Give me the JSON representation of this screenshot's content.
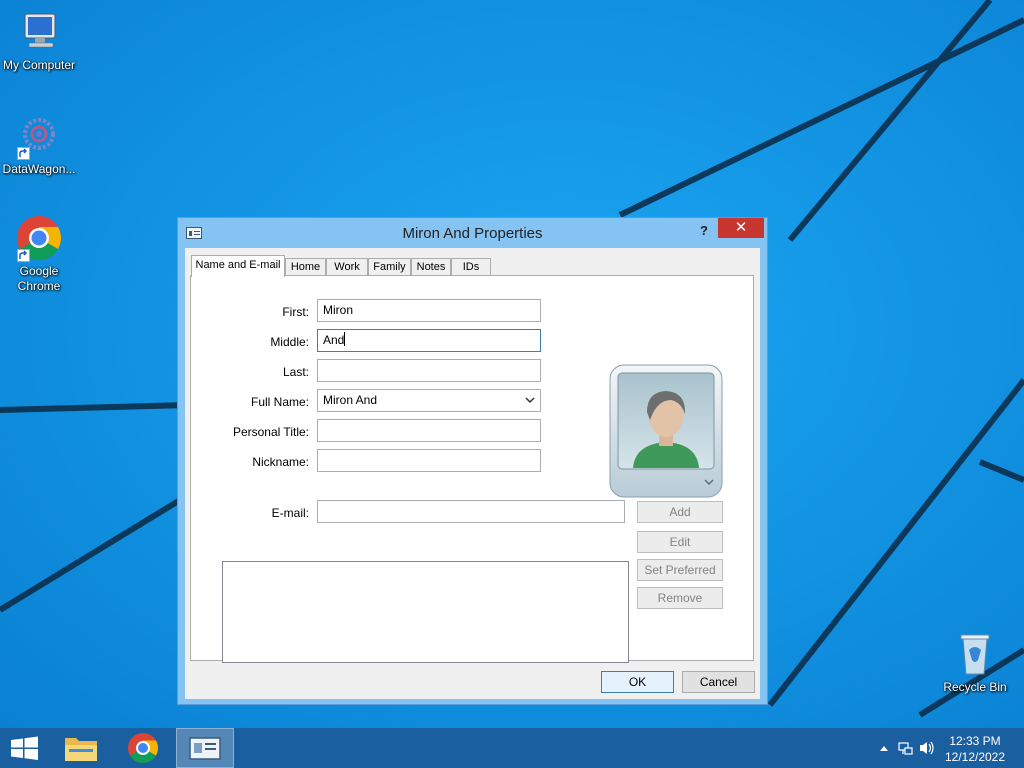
{
  "desktop": {
    "icons": [
      {
        "label": "My Computer",
        "icon": "my-computer-icon"
      },
      {
        "label": "DataWagon...",
        "icon": "datawagon-icon"
      },
      {
        "label": "Google Chrome",
        "icon": "chrome-icon"
      },
      {
        "label": "Recycle Bin",
        "icon": "recycle-bin-icon"
      }
    ]
  },
  "dialog": {
    "title": "Miron And Properties",
    "help_label": "?",
    "close_label": "✕",
    "tabs": [
      "Name and E-mail",
      "Home",
      "Work",
      "Family",
      "Notes",
      "IDs"
    ],
    "active_tab": "Name and E-mail",
    "form": {
      "first_label": "First:",
      "first_value": "Miron",
      "middle_label": "Middle:",
      "middle_value": "And",
      "last_label": "Last:",
      "last_value": "",
      "fullname_label": "Full Name:",
      "fullname_value": "Miron And",
      "title_label": "Personal Title:",
      "title_value": "",
      "nickname_label": "Nickname:",
      "nickname_value": "",
      "email_label": "E-mail:",
      "email_value": ""
    },
    "email_buttons": {
      "add": "Add",
      "edit": "Edit",
      "set_preferred": "Set Preferred",
      "remove": "Remove"
    },
    "footer": {
      "ok": "OK",
      "cancel": "Cancel"
    }
  },
  "taskbar": {
    "items": [
      "start-icon",
      "file-explorer-icon",
      "chrome-icon",
      "contact-properties-icon"
    ],
    "clock_time": "12:33 PM",
    "clock_date": "12/12/2022"
  },
  "colors": {
    "desktop": "#1190e0",
    "dialog_frame": "#84c3f2",
    "close_button": "#c7372f",
    "taskbar": "#1a5fa0"
  }
}
